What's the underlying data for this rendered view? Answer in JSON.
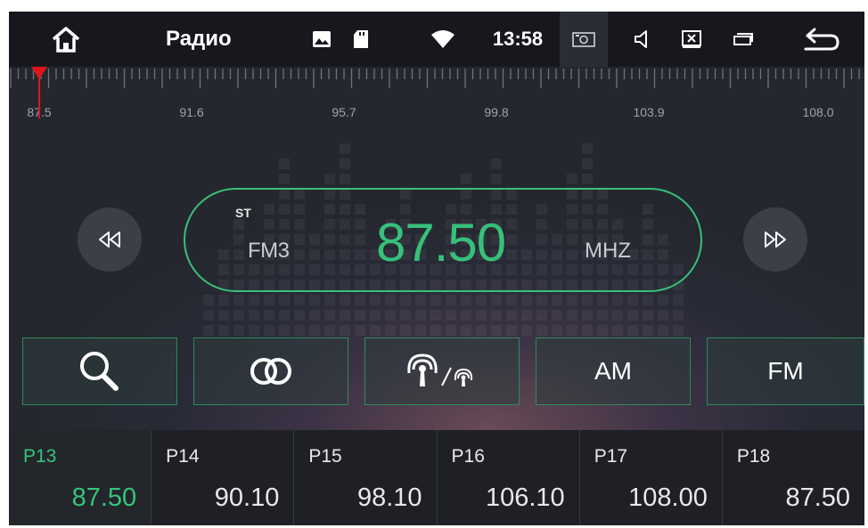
{
  "status_bar": {
    "title": "Радио",
    "time": "13:58",
    "icons": [
      "home-icon",
      "gallery-icon",
      "sd-card-icon",
      "wifi-icon",
      "camera-icon",
      "volume-icon",
      "close-window-icon",
      "window-icon",
      "back-icon"
    ]
  },
  "dial": {
    "labels": [
      "87.5",
      "91.6",
      "95.7",
      "99.8",
      "103.9",
      "108.0"
    ],
    "needle_color": "#e0131b"
  },
  "tuner": {
    "stereo": "ST",
    "band": "FM3",
    "frequency": "87.50",
    "unit": "MHZ",
    "accent_color": "#37c07a"
  },
  "controls": {
    "seek_back_icon": "rewind-icon",
    "seek_forward_icon": "fast-forward-icon",
    "search_icon": "search-icon",
    "stereo_icon": "stereo-rings-icon",
    "signal_icon": "antenna-local-distance-icon",
    "am_label": "AM",
    "fm_label": "FM"
  },
  "presets": [
    {
      "name": "P13",
      "freq": "87.50",
      "active": true
    },
    {
      "name": "P14",
      "freq": "90.10",
      "active": false
    },
    {
      "name": "P15",
      "freq": "98.10",
      "active": false
    },
    {
      "name": "P16",
      "freq": "106.10",
      "active": false
    },
    {
      "name": "P17",
      "freq": "108.00",
      "active": false
    },
    {
      "name": "P18",
      "freq": "87.50",
      "active": false
    }
  ]
}
